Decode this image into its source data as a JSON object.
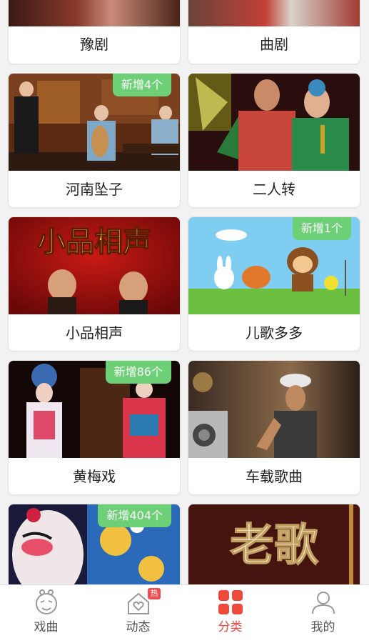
{
  "cards": [
    {
      "label": "豫剧",
      "badge": ""
    },
    {
      "label": "曲剧",
      "badge": ""
    },
    {
      "label": "河南坠子",
      "badge": "新增4个"
    },
    {
      "label": "二人转",
      "badge": ""
    },
    {
      "label": "小品相声",
      "badge": "",
      "banner_text": "小品相声"
    },
    {
      "label": "儿歌多多",
      "badge": "新增1个"
    },
    {
      "label": "黄梅戏",
      "badge": "新增86个"
    },
    {
      "label": "车载歌曲",
      "badge": ""
    },
    {
      "label": "",
      "badge": "新增404个"
    },
    {
      "label": "",
      "badge": "",
      "banner_text": "老歌"
    }
  ],
  "tabbar": {
    "items": [
      {
        "label": "戏曲",
        "icon": "opera-mask-icon",
        "active": false
      },
      {
        "label": "动态",
        "icon": "heart-house-icon",
        "active": false,
        "hot_badge": "热"
      },
      {
        "label": "分类",
        "icon": "category-grid-icon",
        "active": true
      },
      {
        "label": "我的",
        "icon": "user-profile-icon",
        "active": false
      }
    ]
  },
  "colors": {
    "accent": "#ee4a3c",
    "badge_green": "#6dd076",
    "background": "#f2f2f2"
  }
}
